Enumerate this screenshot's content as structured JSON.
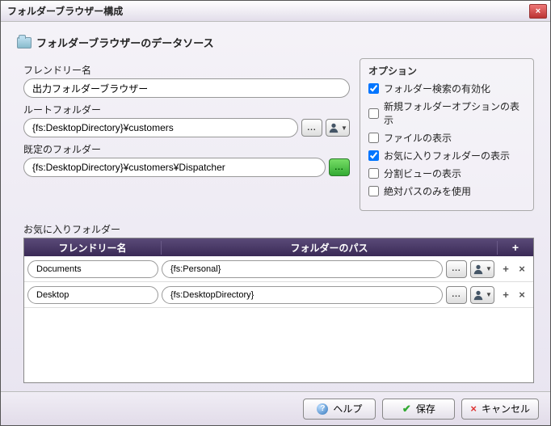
{
  "title": "フォルダーブラウザー構成",
  "header": "フォルダーブラウザーのデータソース",
  "friendly": {
    "label": "フレンドリー名",
    "value": "出力フォルダーブラウザー"
  },
  "root": {
    "label": "ルートフォルダー",
    "value": "{fs:DesktopDirectory}¥customers"
  },
  "default": {
    "label": "既定のフォルダー",
    "value": "{fs:DesktopDirectory}¥customers¥Dispatcher"
  },
  "options": {
    "title": "オプション",
    "items": [
      {
        "label": "フォルダー検索の有効化",
        "checked": true
      },
      {
        "label": "新規フォルダーオプションの表示",
        "checked": false
      },
      {
        "label": "ファイルの表示",
        "checked": false
      },
      {
        "label": "お気に入りフォルダーの表示",
        "checked": true
      },
      {
        "label": "分割ビューの表示",
        "checked": false
      },
      {
        "label": "絶対パスのみを使用",
        "checked": false
      }
    ]
  },
  "favorites": {
    "label": "お気に入りフォルダー",
    "header_name": "フレンドリー名",
    "header_path": "フォルダーのパス",
    "add": "+",
    "rows": [
      {
        "name": "Documents",
        "path": "{fs:Personal}"
      },
      {
        "name": "Desktop",
        "path": "{fs:DesktopDirectory}"
      }
    ]
  },
  "footer": {
    "help": "ヘルプ",
    "save": "保存",
    "cancel": "キャンセル"
  },
  "glyphs": {
    "dots": "...",
    "plus": "+",
    "x": "×",
    "check": "✔",
    "q": "?"
  }
}
